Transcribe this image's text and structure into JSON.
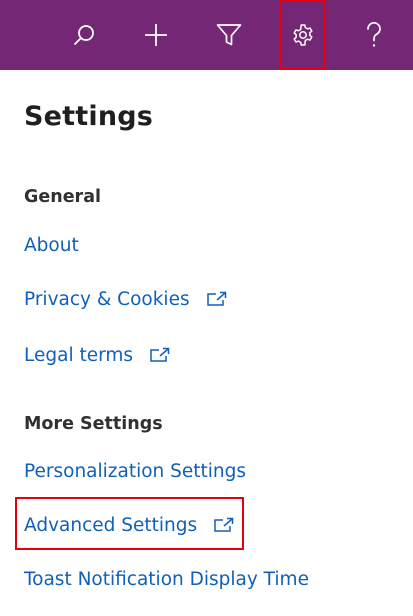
{
  "topbar": {
    "background": "#742774",
    "buttons": [
      {
        "icon": "search-icon"
      },
      {
        "icon": "plus-icon"
      },
      {
        "icon": "filter-icon"
      },
      {
        "icon": "gear-icon"
      },
      {
        "icon": "question-icon"
      }
    ]
  },
  "panel": {
    "title": "Settings",
    "general": {
      "heading": "General",
      "links": [
        "About",
        "Privacy & Cookies",
        "Legal terms"
      ]
    },
    "more": {
      "heading": "More Settings",
      "links": [
        "Personalization Settings",
        "Advanced Settings",
        "Toast Notification Display Time"
      ]
    }
  },
  "colors": {
    "link": "#1160b7",
    "highlight": "#e3000f"
  }
}
